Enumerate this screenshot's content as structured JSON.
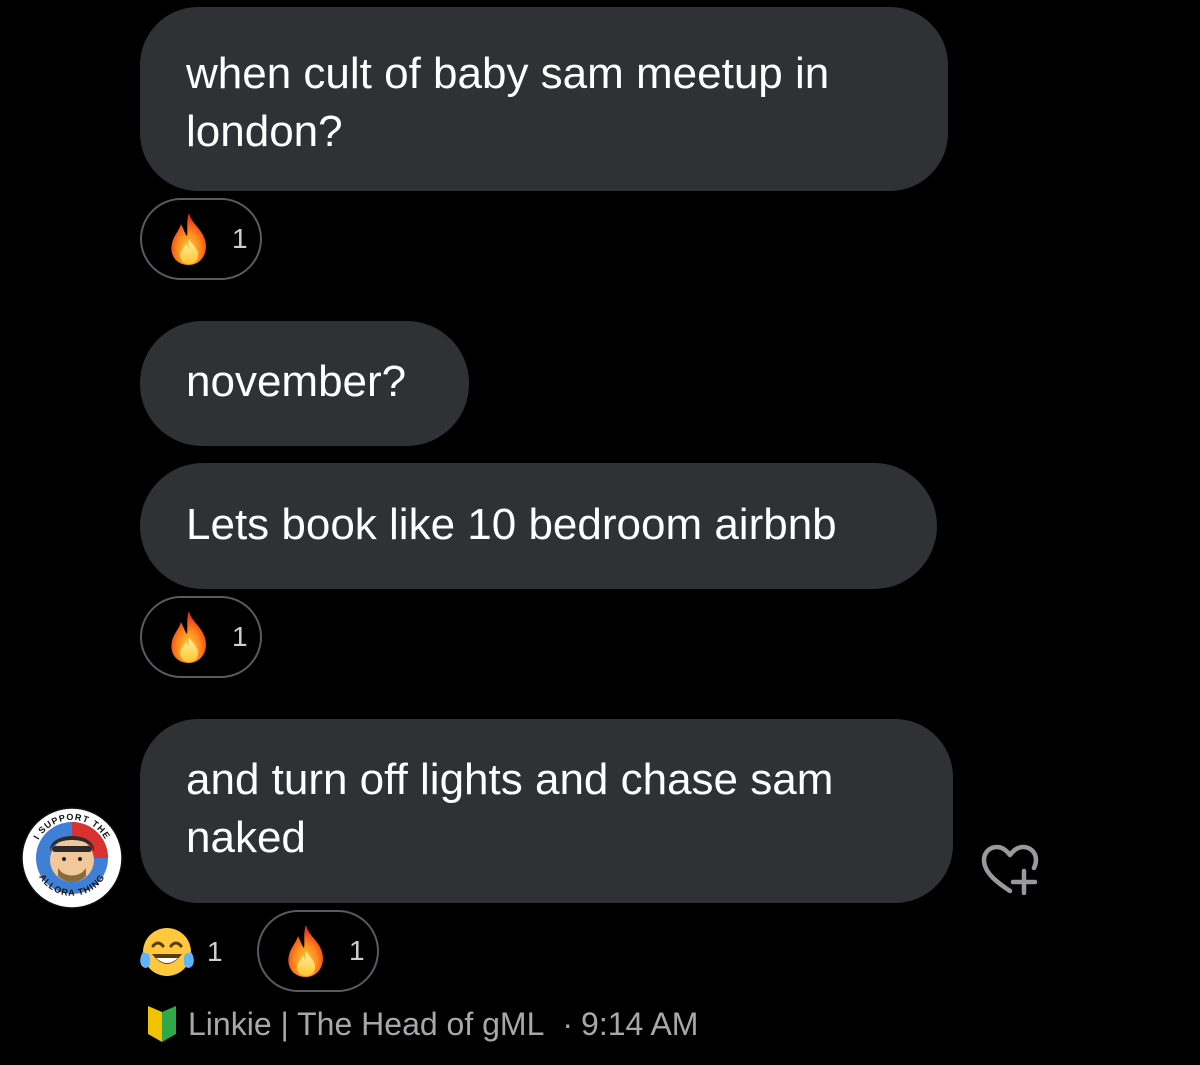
{
  "messages": [
    {
      "text": "when cult of baby sam meetup in\nlondon?",
      "reactions": [
        {
          "icon": "fire-emoji",
          "count": "1"
        }
      ]
    },
    {
      "text": "november?",
      "reactions": []
    },
    {
      "text": "Lets book like 10 bedroom airbnb",
      "reactions": [
        {
          "icon": "fire-emoji",
          "count": "1"
        }
      ]
    },
    {
      "text": "and turn off lights and chase sam\nnaked",
      "reactions": [
        {
          "icon": "tears-of-joy-emoji",
          "count": "1"
        },
        {
          "icon": "fire-emoji",
          "count": "1"
        }
      ]
    }
  ],
  "avatar": {
    "icon": "avatar-badge",
    "ring_text_top": "I SUPPORT THE",
    "ring_text_bottom": "ALLORA THING"
  },
  "sender": {
    "badge_icon": "japanese-beginner-symbol",
    "name": "Linkie | The Head of gML",
    "separator": "·",
    "time": "9:14 AM"
  },
  "actions": {
    "add_reaction_icon": "heart-plus-icon"
  },
  "colors": {
    "background": "#000000",
    "bubble": "#303134",
    "pill_border": "#5a5b5e",
    "meta_text": "#a8a8ab"
  }
}
